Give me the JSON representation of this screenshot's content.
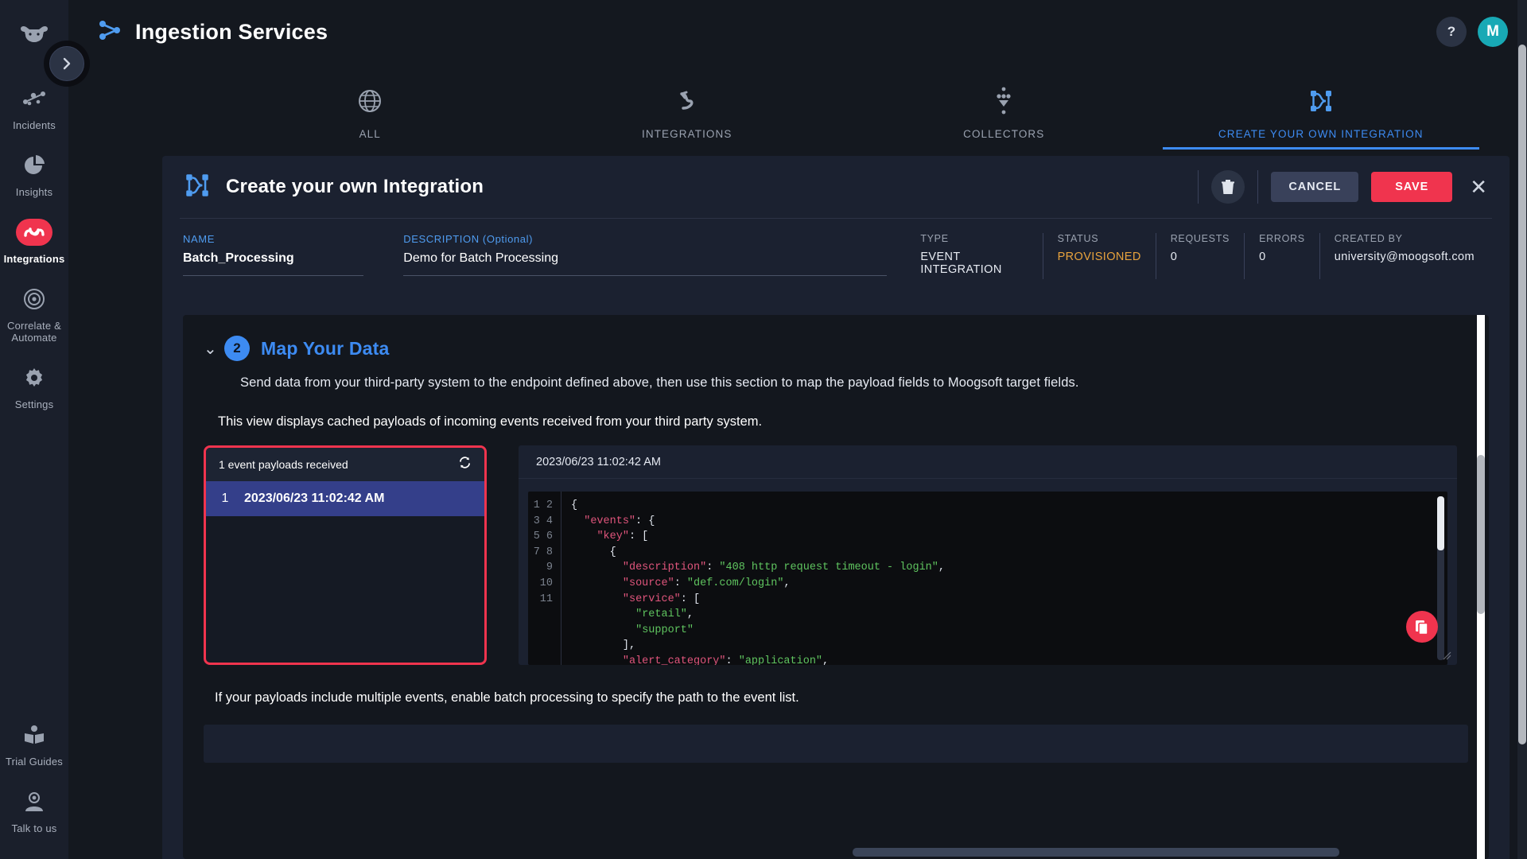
{
  "sidebar": {
    "logo_icon": "moogsoft-cow-logo",
    "expander_icon": "chevron-right-icon",
    "items": [
      {
        "label": "Incidents",
        "icon": "incidents-nodes-icon",
        "active": false
      },
      {
        "label": "Insights",
        "icon": "pie-chart-icon",
        "active": false
      },
      {
        "label": "Integrations",
        "icon": "integrations-swirl-icon",
        "active": true
      },
      {
        "label": "Correlate &\nAutomate",
        "icon": "radar-target-icon",
        "active": false
      },
      {
        "label": "Settings",
        "icon": "gear-icon",
        "active": false
      }
    ],
    "bottom_items": [
      {
        "label": "Trial Guides",
        "icon": "open-book-icon"
      },
      {
        "label": "Talk to us",
        "icon": "support-person-icon"
      }
    ]
  },
  "topbar": {
    "title": "Ingestion Services",
    "title_icon": "share-nodes-icon",
    "help_label": "?",
    "avatar_label": "M"
  },
  "tabs": [
    {
      "label": "ALL",
      "icon": "globe-icon",
      "active": false
    },
    {
      "label": "INTEGRATIONS",
      "icon": "integrations-arrow-icon",
      "active": false
    },
    {
      "label": "COLLECTORS",
      "icon": "collectors-funnel-icon",
      "active": false
    },
    {
      "label": "CREATE YOUR OWN INTEGRATION",
      "icon": "custom-integration-icon",
      "active": true
    }
  ],
  "card": {
    "title": "Create your own Integration",
    "title_icon": "custom-integration-icon",
    "delete_icon": "trash-icon",
    "cancel_label": "CANCEL",
    "save_label": "SAVE",
    "close_icon": "close-icon",
    "accent_color": "#f0344e",
    "link_color": "#3d8bf2"
  },
  "meta": {
    "name_label": "NAME",
    "name_value": "Batch_Processing",
    "description_label": "DESCRIPTION (Optional)",
    "description_value": "Demo for Batch Processing",
    "stats": [
      {
        "label": "TYPE",
        "value": "EVENT INTEGRATION",
        "warn": false
      },
      {
        "label": "STATUS",
        "value": "PROVISIONED",
        "warn": true
      },
      {
        "label": "REQUESTS",
        "value": "0",
        "warn": false
      },
      {
        "label": "ERRORS",
        "value": "0",
        "warn": false
      },
      {
        "label": "CREATED BY",
        "value": "university@moogsoft.com",
        "warn": false
      }
    ]
  },
  "section": {
    "collapse_icon": "chevron-down-icon",
    "step_number": "2",
    "title": "Map Your Data",
    "subtitle": "Send data from your third-party system to the endpoint defined above, then use this section to map the payload fields to Moogsoft target fields.",
    "note": "This view displays cached payloads of incoming events received from your third party system.",
    "batch_note": "If your payloads include multiple events, enable batch processing to specify the path to the event list."
  },
  "events": {
    "header_label": "1 event payloads received",
    "refresh_icon": "refresh-icon",
    "rows": [
      {
        "num": "1",
        "timestamp": "2023/06/23 11:02:42 AM",
        "selected": true
      }
    ]
  },
  "json_panel": {
    "header_timestamp": "2023/06/23 11:02:42 AM",
    "copy_icon": "copy-icon",
    "line_numbers": [
      "1",
      "2",
      "3",
      "4",
      "5",
      "6",
      "7",
      "8",
      "9",
      "10",
      "11"
    ],
    "code_lines": [
      "{",
      "  \"events\": {",
      "    \"key\": [",
      "      {",
      "        \"description\": \"408 http request timeout - login\",",
      "        \"source\": \"def.com/login\",",
      "        \"service\": [",
      "          \"retail\",",
      "          \"support\"",
      "        ],",
      "        \"alert_category\": \"application\","
    ]
  },
  "scrollbars": {
    "vertical_inner": "content-scrollbar",
    "vertical_page": "page-scrollbar",
    "horizontal": "horizontal-scrollbar"
  }
}
